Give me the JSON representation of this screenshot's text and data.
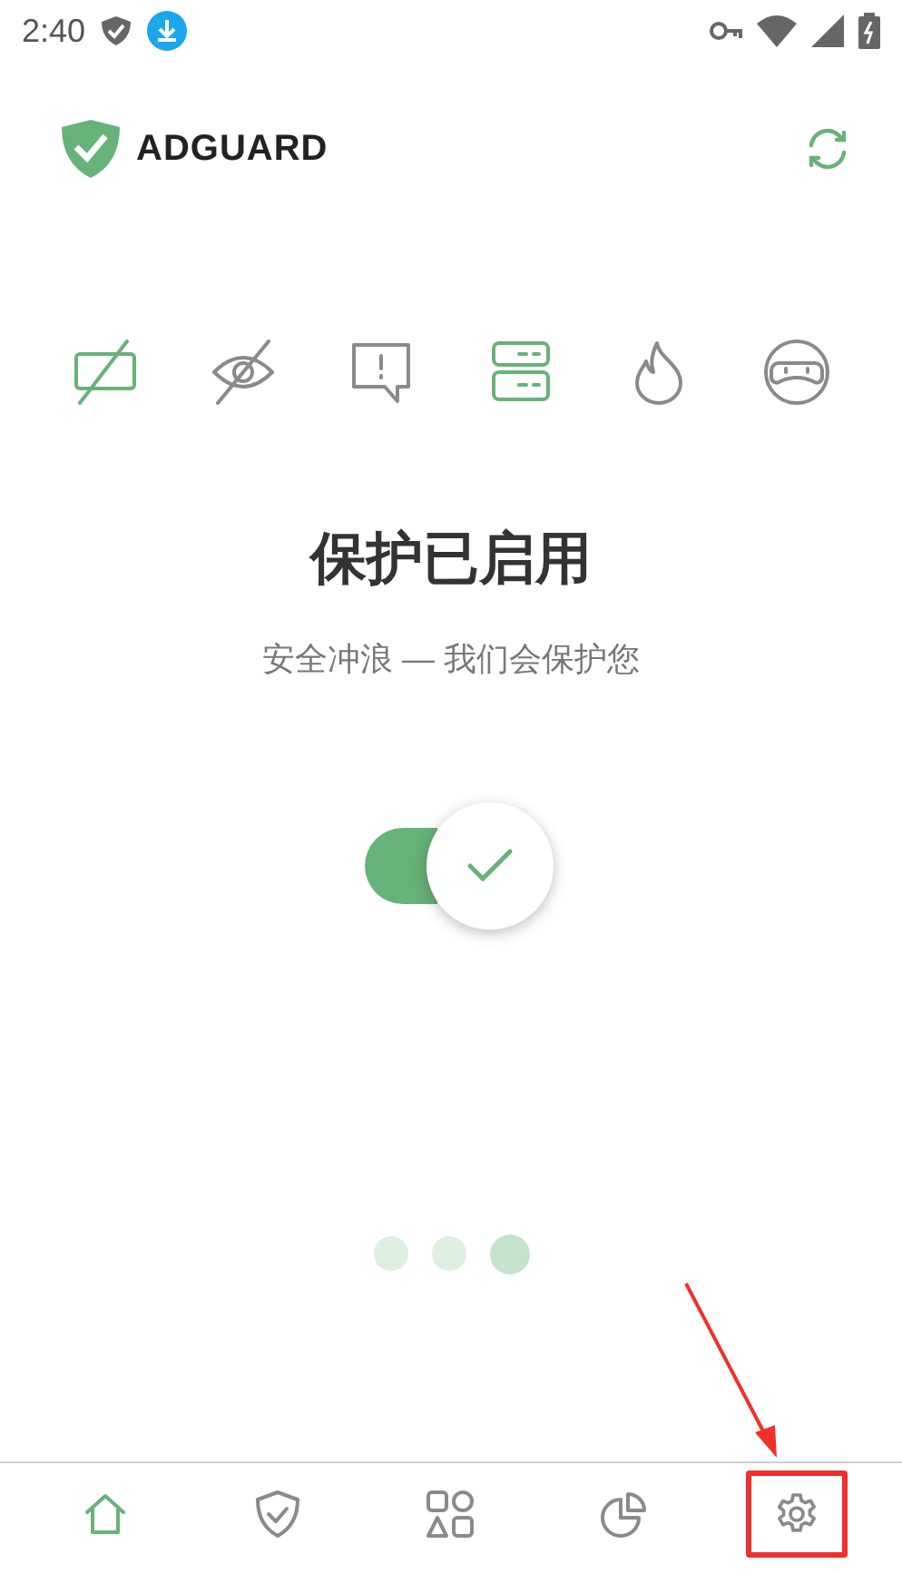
{
  "status_bar": {
    "time": "2:40"
  },
  "header": {
    "logo": "ADGUARD"
  },
  "features": [
    {
      "kind": "ads",
      "on": true
    },
    {
      "kind": "tracking",
      "on": false
    },
    {
      "kind": "annoyances",
      "on": false
    },
    {
      "kind": "dns",
      "on": true
    },
    {
      "kind": "firewall",
      "on": false
    },
    {
      "kind": "stealth",
      "on": false
    }
  ],
  "status": {
    "title": "保护已启用",
    "subtitle": "安全冲浪 — 我们会保护您"
  },
  "protection_switch": {
    "on": true
  },
  "pager": [
    {
      "selected": false
    },
    {
      "selected": false
    },
    {
      "selected": true
    }
  ],
  "bottom_nav": [
    {
      "kind": "home",
      "selected": true
    },
    {
      "kind": "protection",
      "selected": false
    },
    {
      "kind": "apps",
      "selected": false
    },
    {
      "kind": "stats",
      "selected": false
    },
    {
      "kind": "settings",
      "selected": false,
      "highlighted": true
    }
  ]
}
